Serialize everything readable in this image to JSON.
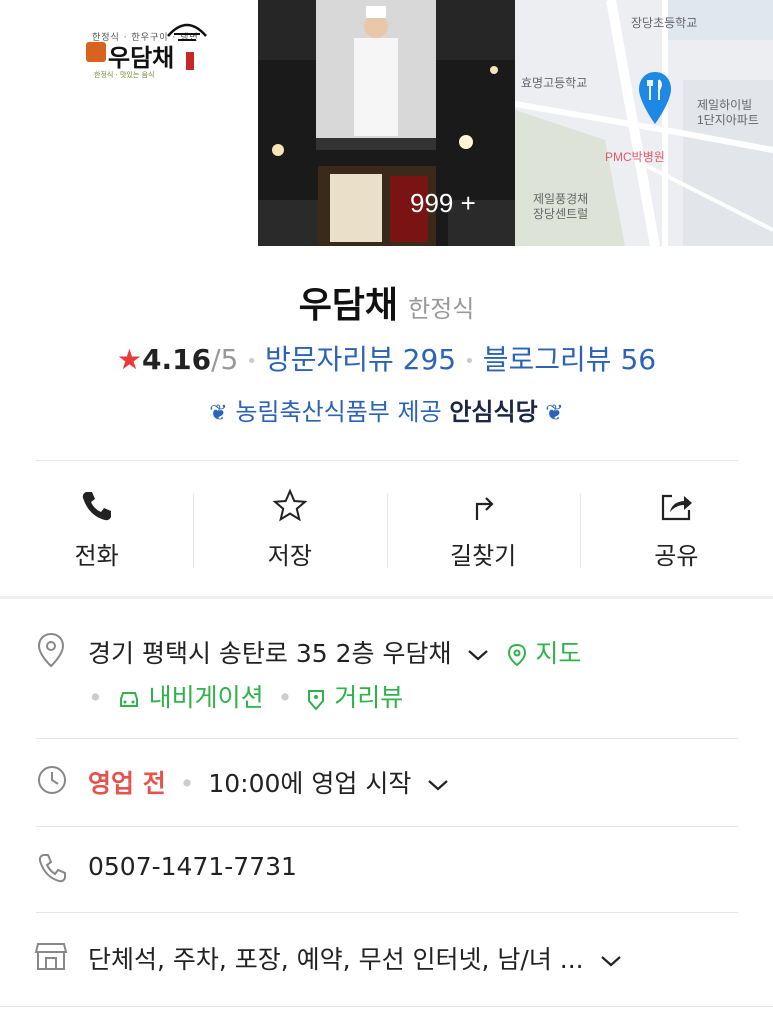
{
  "gallery": {
    "logo": {
      "small_text": "한정식 · 한우구이 · 냉면",
      "name": "우담채",
      "sub_text": "한정식 · 맛있는 음식"
    },
    "photo_count": "999 +",
    "map_labels": {
      "school1": "장당초등학교",
      "school2": "효명고등학교",
      "apt": "제일하이빌\n1단지아파트",
      "hospital": "PMC박병원",
      "center": "제일풍경채\n장당센트럴"
    }
  },
  "place": {
    "name": "우담채",
    "category": "한정식",
    "rating": "4.16",
    "rating_max": "/5",
    "visitor_reviews": "방문자리뷰 295",
    "blog_reviews": "블로그리뷰 56",
    "badge_text": "농림축산식품부 제공",
    "badge_strong": "안심식당"
  },
  "actions": [
    {
      "label": "전화",
      "icon": "phone-icon"
    },
    {
      "label": "저장",
      "icon": "star-icon"
    },
    {
      "label": "길찾기",
      "icon": "directions-icon"
    },
    {
      "label": "공유",
      "icon": "share-icon"
    }
  ],
  "info": {
    "address": "경기 평택시 송탄로 35 2층 우담채",
    "map_link": "지도",
    "navigation_link": "내비게이션",
    "streetview_link": "거리뷰",
    "status": "영업 전",
    "hours": "10:00에 영업 시작",
    "phone": "0507-1471-7731",
    "amenities": "단체석, 주차, 포장, 예약, 무선 인터넷, 남/녀 ..."
  },
  "colors": {
    "accent_blue": "#2b63b8",
    "green": "#2fb24c",
    "star_red": "#e83a3a",
    "status_red": "#e4544c",
    "map_pin": "#1e88e5"
  }
}
